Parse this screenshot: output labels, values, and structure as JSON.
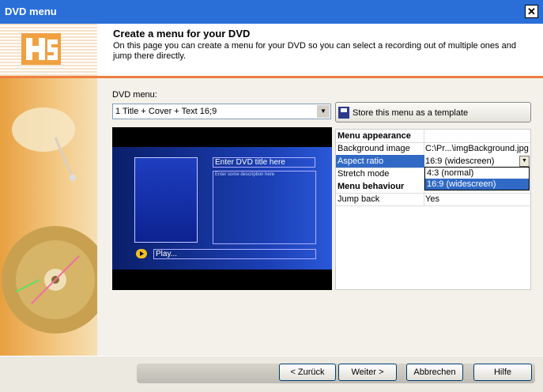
{
  "window": {
    "title": "DVD menu",
    "close_icon": "close-icon"
  },
  "header": {
    "title": "Create a menu for your DVD",
    "description": "On this page you can create a menu for your DVD so you can select a recording out of multiple ones and jump there directly.",
    "logo_text": "HS"
  },
  "form": {
    "dvd_menu_label": "DVD menu:",
    "dvd_menu_value": "1 Title + Cover + Text 16;9",
    "store_template_label": "Store this menu as a template",
    "store_icon": "save-icon"
  },
  "preview": {
    "title_placeholder": "Enter DVD title here",
    "description_placeholder": "Enter some description here",
    "play_label": "Play..."
  },
  "properties": {
    "rows": [
      {
        "key": "Menu appearance",
        "value": "",
        "type": "section"
      },
      {
        "key": "Background image",
        "value": "C:\\Pr...\\imgBackground.jpg"
      },
      {
        "key": "Aspect ratio",
        "value": "16:9 (widescreen)",
        "selected": true
      },
      {
        "key": "Stretch mode",
        "value": ""
      },
      {
        "key": "Menu behaviour",
        "value": "",
        "type": "section"
      },
      {
        "key": "Jump back",
        "value": "Yes"
      }
    ],
    "aspect_options": [
      "4:3 (normal)",
      "16:9 (widescreen)"
    ],
    "aspect_selected": "16:9 (widescreen)"
  },
  "buttons": {
    "back": "< Zurück",
    "next": "Weiter >",
    "cancel": "Abbrechen",
    "help": "Hilfe"
  },
  "colors": {
    "titlebar": "#2a6fd8",
    "accent_line": "#f08040",
    "selection": "#316ac5"
  }
}
